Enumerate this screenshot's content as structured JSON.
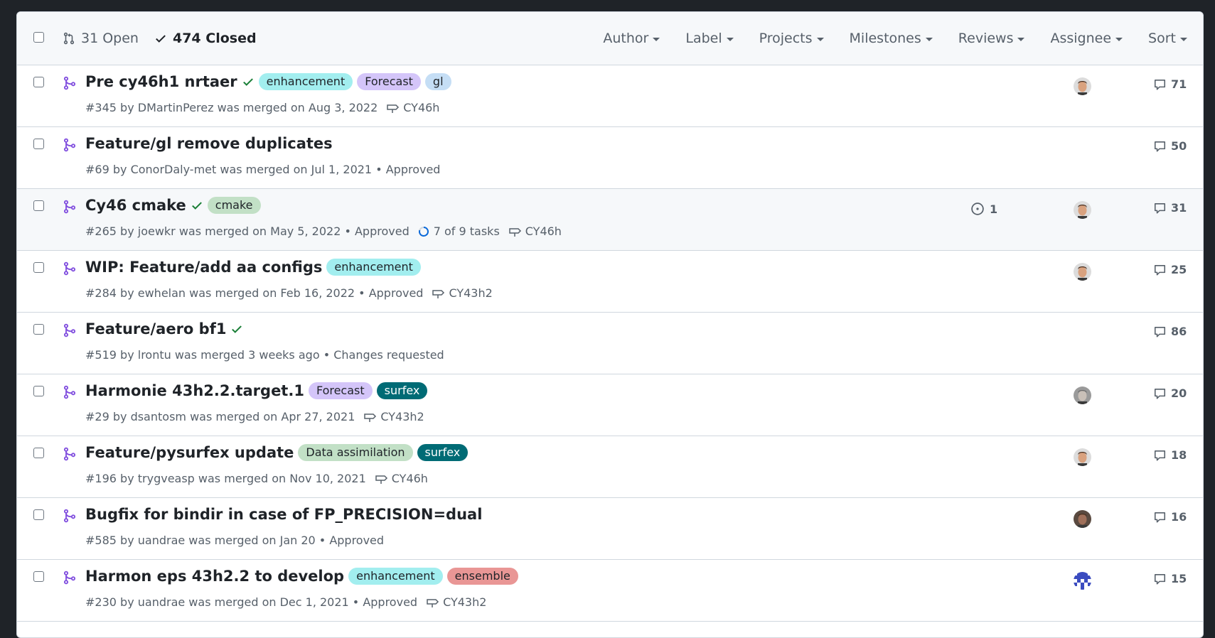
{
  "header": {
    "open_label": "31 Open",
    "closed_label": "474 Closed",
    "filters": [
      "Author",
      "Label",
      "Projects",
      "Milestones",
      "Reviews",
      "Assignee",
      "Sort"
    ]
  },
  "pulls": [
    {
      "title": "Pre cy46h1 nrtaer",
      "check": true,
      "labels": [
        {
          "text": "enhancement",
          "bg": "#a2eeef",
          "fg": "#1f2328"
        },
        {
          "text": "Forecast",
          "bg": "#d4c5f9",
          "fg": "#1f2328"
        },
        {
          "text": "gl",
          "bg": "#c5def5",
          "fg": "#1f2328"
        }
      ],
      "meta": "#345 by DMartinPerez was merged on Aug 3, 2022",
      "milestone": "CY46h",
      "comments": "71",
      "avatar": "face-tan"
    },
    {
      "title": "Feature/gl remove duplicates",
      "check": false,
      "labels": [],
      "meta": "#69 by ConorDaly-met was merged on Jul 1, 2021 • Approved",
      "comments": "50"
    },
    {
      "title": "Cy46 cmake",
      "check": true,
      "labels": [
        {
          "text": "cmake",
          "bg": "#c2e0c6",
          "fg": "#1f2328"
        }
      ],
      "meta": "#265 by joewkr was merged on May 5, 2022 • Approved",
      "tasks": "7 of 9 tasks",
      "milestone": "CY46h",
      "linked_issues": "1",
      "comments": "31",
      "avatar": "face-tan",
      "highlight": true
    },
    {
      "title": "WIP: Feature/add aa configs",
      "check": false,
      "labels": [
        {
          "text": "enhancement",
          "bg": "#a2eeef",
          "fg": "#1f2328"
        }
      ],
      "meta": "#284 by ewhelan was merged on Feb 16, 2022 • Approved",
      "milestone": "CY43h2",
      "comments": "25",
      "avatar": "face-tan"
    },
    {
      "title": "Feature/aero bf1",
      "check": true,
      "labels": [],
      "meta": "#519 by lrontu was merged 3 weeks ago • Changes requested",
      "comments": "86"
    },
    {
      "title": "Harmonie 43h2.2.target.1",
      "check": false,
      "labels": [
        {
          "text": "Forecast",
          "bg": "#d4c5f9",
          "fg": "#1f2328"
        },
        {
          "text": "surfex",
          "bg": "#006b75",
          "fg": "#ffffff"
        }
      ],
      "meta": "#29 by dsantosm was merged on Apr 27, 2021",
      "milestone": "CY43h2",
      "comments": "20",
      "avatar": "face-grey"
    },
    {
      "title": "Feature/pysurfex update",
      "check": false,
      "labels": [
        {
          "text": "Data assimilation",
          "bg": "#c2e0c6",
          "fg": "#1f2328"
        },
        {
          "text": "surfex",
          "bg": "#006b75",
          "fg": "#ffffff"
        }
      ],
      "meta": "#196 by trygveasp was merged on Nov 10, 2021",
      "milestone": "CY46h",
      "comments": "18",
      "avatar": "face-tan"
    },
    {
      "title": "Bugfix for bindir in case of FP_PRECISION=dual",
      "check": false,
      "labels": [],
      "meta": "#585 by uandrae was merged on Jan 20 • Approved",
      "comments": "16",
      "avatar": "face-dark"
    },
    {
      "title": "Harmon eps 43h2.2 to develop",
      "check": false,
      "labels": [
        {
          "text": "enhancement",
          "bg": "#a2eeef",
          "fg": "#1f2328"
        },
        {
          "text": "ensemble",
          "bg": "#e99695",
          "fg": "#1f2328"
        }
      ],
      "meta": "#230 by uandrae was merged on Dec 1, 2021 • Approved",
      "milestone": "CY43h2",
      "comments": "15",
      "avatar": "identicon-blue"
    }
  ],
  "colors": {
    "merged": "#8250df",
    "success": "#1a7f37",
    "muted": "#57606a",
    "progress": "#0969da"
  }
}
